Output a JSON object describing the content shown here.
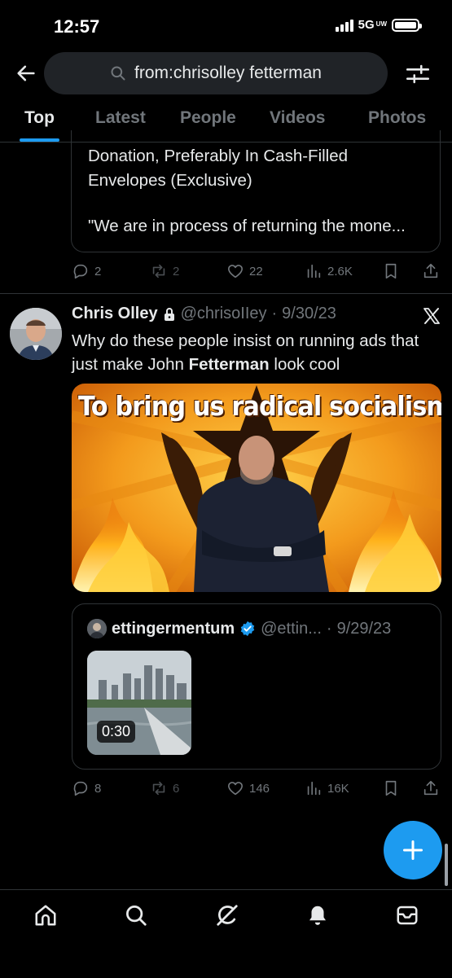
{
  "status_bar": {
    "time": "12:57",
    "network": "5G",
    "network_sub": "UW"
  },
  "search": {
    "query": "from:chrisolley fetterman",
    "icon": "search-icon"
  },
  "tabs": [
    {
      "label": "Top",
      "active": true
    },
    {
      "label": "Latest",
      "active": false
    },
    {
      "label": "People",
      "active": false
    },
    {
      "label": "Videos",
      "active": false
    },
    {
      "label": "Photos",
      "active": false
    }
  ],
  "previous_tweet": {
    "quote_lines": [
      "Donation, Preferably In Cash-Filled",
      "Envelopes (Exclusive)",
      "",
      "\"We are in process of returning the mone..."
    ],
    "actions": {
      "replies": "2",
      "retweets": "2",
      "likes": "22",
      "views": "2.6K"
    }
  },
  "tweet": {
    "author_name": "Chris Olley",
    "lock_icon": "lock-icon",
    "handle": "@chrisoIIey",
    "separator": "·",
    "date": "9/30/23",
    "text_before": "Why do these people insist on running ads that just make John ",
    "text_bold": "Fetterman",
    "text_after": " look cool",
    "media_caption": "To bring us radical socialism.",
    "quote": {
      "author_name": "ettingermentum",
      "handle": "@ettin...",
      "separator": "·",
      "date": "9/29/23",
      "video_duration": "0:30"
    },
    "actions": {
      "replies": "8",
      "retweets": "6",
      "likes": "146",
      "views": "16K"
    }
  },
  "colors": {
    "accent": "#1d9bf0",
    "muted": "#71767b",
    "border": "#2f3336",
    "background": "#000000"
  },
  "bottom_nav": [
    "home-icon",
    "explore-icon",
    "grok-icon",
    "notifications-icon",
    "messages-icon"
  ]
}
